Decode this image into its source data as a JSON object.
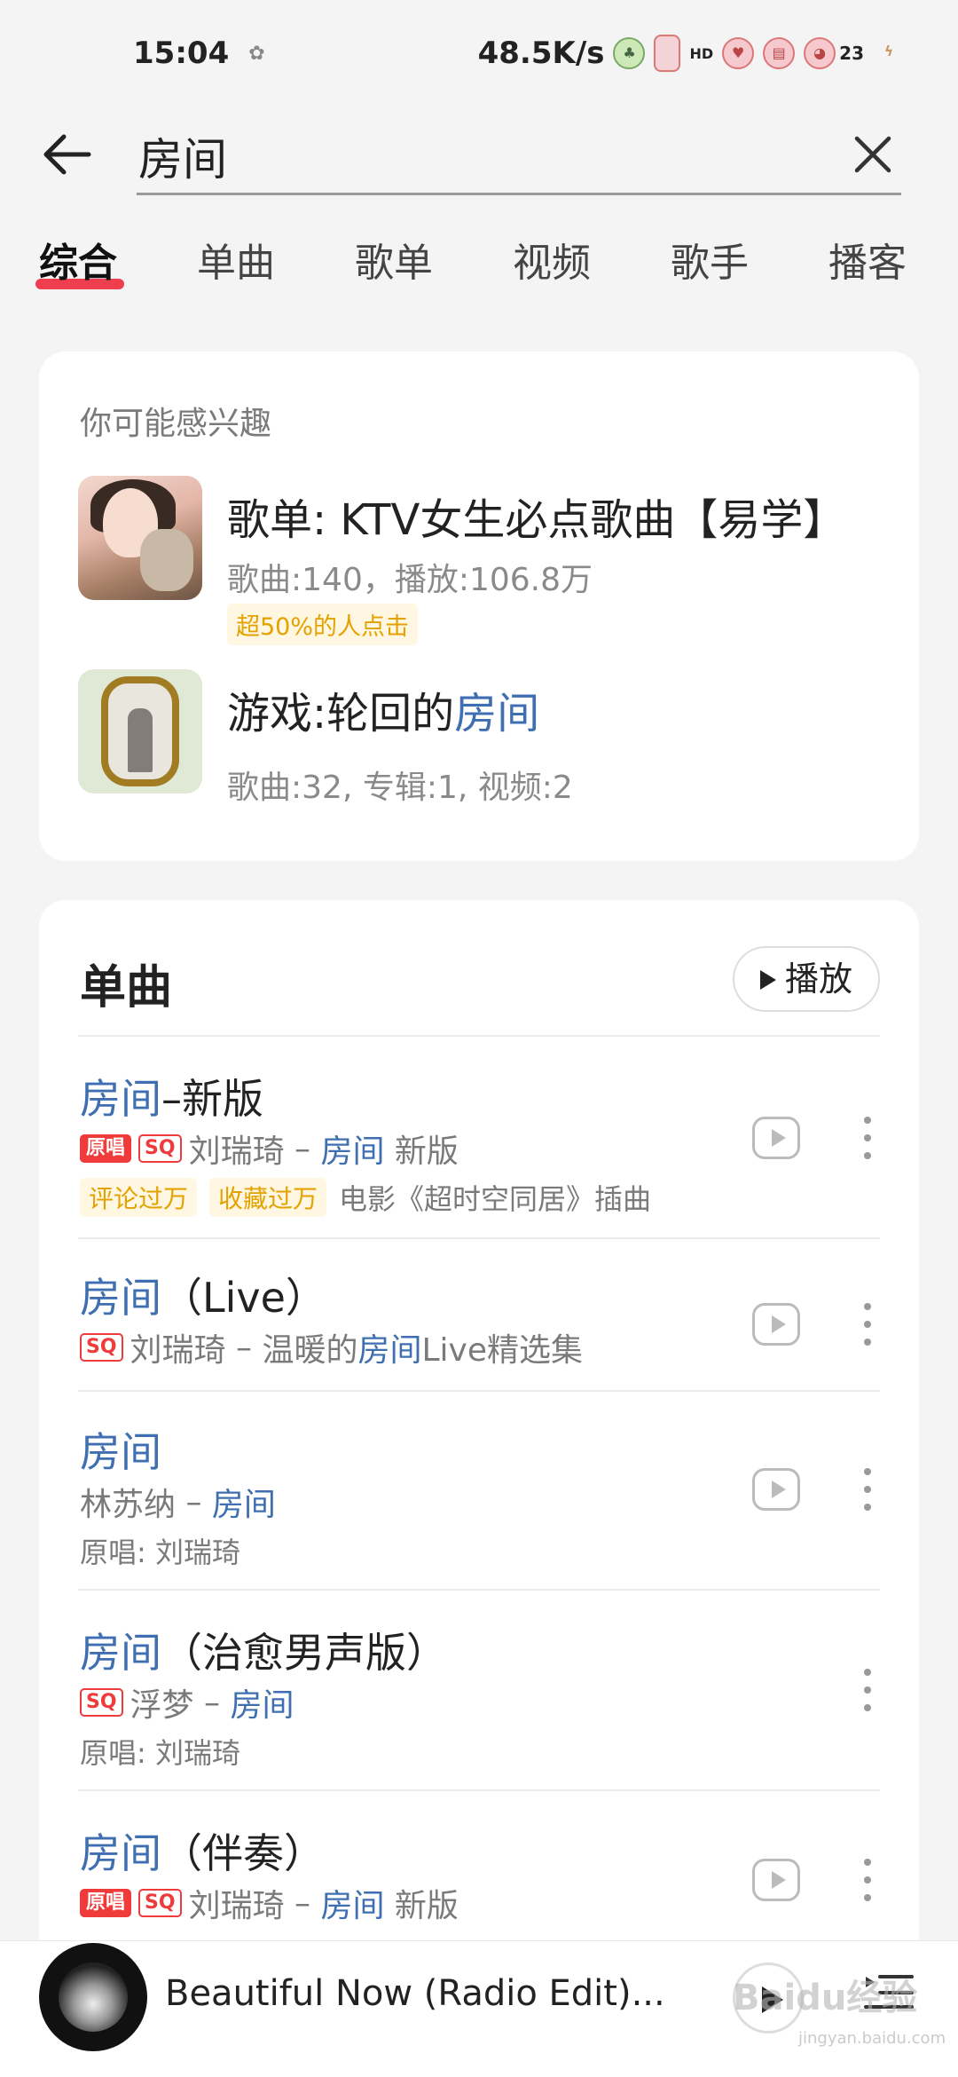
{
  "status_bar": {
    "time": "15:04",
    "net_speed": "48.5K/s",
    "hd_label": "HD",
    "notif_count": "23"
  },
  "search": {
    "query": "房间"
  },
  "tabs": [
    {
      "label": "综合",
      "active": true
    },
    {
      "label": "单曲"
    },
    {
      "label": "歌单"
    },
    {
      "label": "视频"
    },
    {
      "label": "歌手"
    },
    {
      "label": "播客"
    }
  ],
  "interest": {
    "heading": "你可能感兴趣",
    "items": [
      {
        "title": "歌单: KTV女生必点歌曲【易学】",
        "meta": "歌曲:140，播放:106.8万",
        "pill": "超50%的人点击"
      },
      {
        "title_prefix": "游戏:轮回的",
        "title_highlight": "房间",
        "meta": "歌曲:32, 专辑:1, 视频:2"
      }
    ]
  },
  "songs_section": {
    "heading": "单曲",
    "play_all_label": "播放",
    "songs": [
      {
        "title_highlight": "房间",
        "title_rest": "–新版",
        "badge_orig": "原唱",
        "badge_sq": "SQ",
        "artist": "刘瑞琦",
        "sep": " – ",
        "album_highlight": "房间",
        "album_rest": " 新版",
        "tags": [
          "评论过万",
          "收藏过万"
        ],
        "extra": "电影《超时空同居》插曲"
      },
      {
        "title_highlight": "房间",
        "title_rest": "（Live）",
        "badge_sq": "SQ",
        "artist": "刘瑞琦",
        "sep": " – ",
        "album_prefix": "温暖的",
        "album_highlight": "房间",
        "album_rest": "Live精选集"
      },
      {
        "title_highlight": "房间",
        "title_rest": "",
        "artist": "林苏纳",
        "sep": " – ",
        "album_highlight": "房间",
        "original": "原唱: 刘瑞琦"
      },
      {
        "title_highlight": "房间",
        "title_rest": "（治愈男声版）",
        "badge_sq": "SQ",
        "artist": "浮梦",
        "sep": " – ",
        "album_highlight": "房间",
        "original": "原唱: 刘瑞琦"
      },
      {
        "title_highlight": "房间",
        "title_rest": "（伴奏）",
        "badge_orig": "原唱",
        "badge_sq": "SQ",
        "artist": "刘瑞琦",
        "sep": " – ",
        "album_highlight": "房间",
        "album_rest": " 新版"
      }
    ]
  },
  "now_playing": {
    "title": "Beautiful Now (Radio Edit)..."
  },
  "watermark": {
    "text": "Baidu经验",
    "sub": "jingyan.baidu.com"
  },
  "colors": {
    "accent_red": "#ee2a3c",
    "highlight_blue": "#3f6fb0",
    "tag_yellow": "#e4a200"
  },
  "icons": [
    "arrow-left-icon",
    "close-icon",
    "play-icon",
    "mv-icon",
    "more-vertical-icon",
    "playlist-icon"
  ]
}
